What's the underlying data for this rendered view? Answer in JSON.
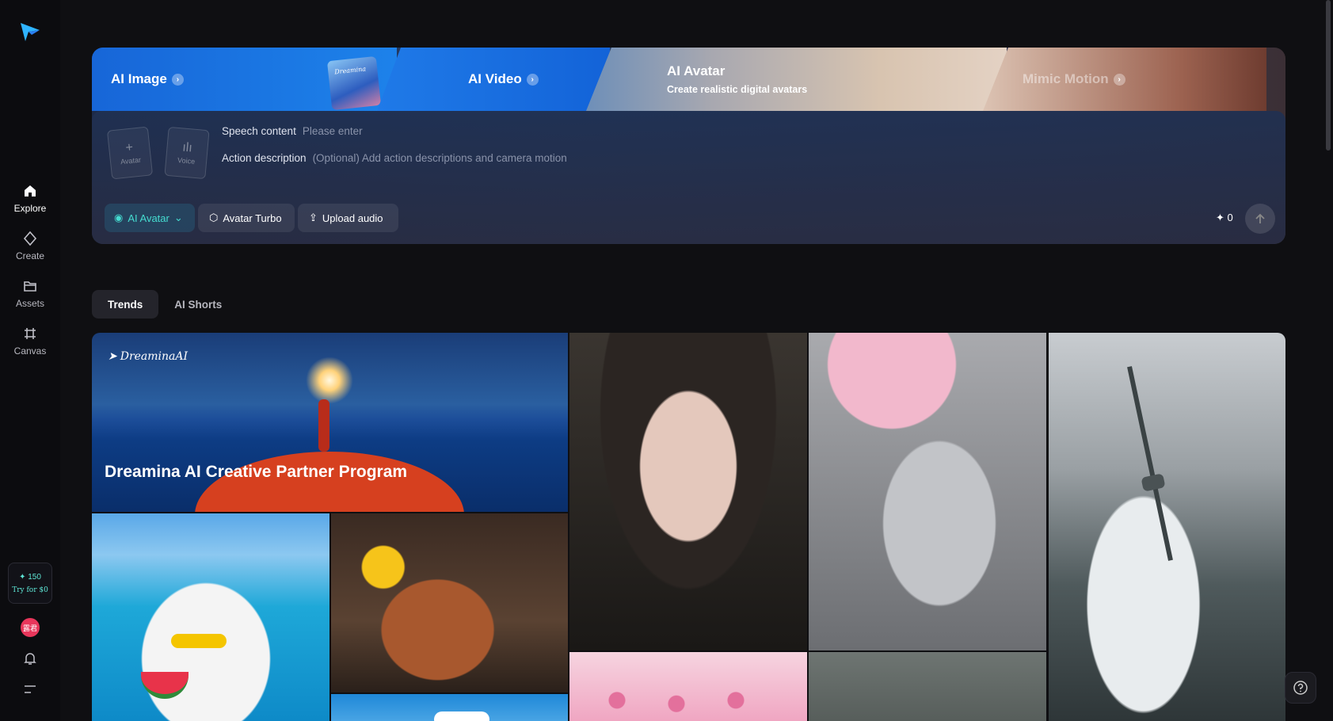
{
  "sidebar": {
    "items": [
      {
        "label": "Explore",
        "icon": "home-icon",
        "active": true
      },
      {
        "label": "Create",
        "icon": "sparkle-diamond-icon",
        "active": false
      },
      {
        "label": "Assets",
        "icon": "folder-icon",
        "active": false
      },
      {
        "label": "Canvas",
        "icon": "canvas-grid-icon",
        "active": false
      }
    ],
    "credits": {
      "amount": "✦ 150",
      "cta": "Try for $0"
    },
    "avatar_text": "露君"
  },
  "hero": {
    "tabs": [
      {
        "label": "AI Image"
      },
      {
        "label": "AI Video"
      },
      {
        "label": "AI Avatar",
        "subtitle": "Create realistic digital avatars"
      },
      {
        "label": "Mimic Motion"
      }
    ],
    "thumb_text": "Dreamina",
    "slots": {
      "avatar": "Avatar",
      "voice": "Voice"
    },
    "speech": {
      "key": "Speech content",
      "placeholder": "Please enter"
    },
    "action": {
      "key": "Action description",
      "placeholder": "(Optional) Add action descriptions and camera motion"
    },
    "buttons": {
      "mode": "AI Avatar",
      "model": "Avatar Turbo",
      "upload": "Upload audio"
    },
    "credit_cost": "0"
  },
  "section_tabs": [
    {
      "label": "Trends",
      "active": true
    },
    {
      "label": "AI Shorts",
      "active": false
    }
  ],
  "gallery": {
    "banner_brand": "DreaminaAI",
    "banner_title": "Dreamina AI Creative Partner Program"
  },
  "colors": {
    "accent": "#45dcd0",
    "background": "#0f0f12",
    "brand_blue": "#1d82ea"
  }
}
